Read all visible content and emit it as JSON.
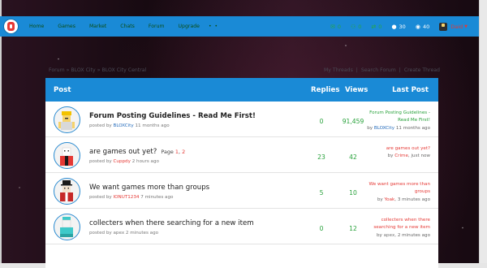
{
  "navbar": {
    "links": [
      "Home",
      "Games",
      "Market",
      "Chats",
      "Forum",
      "Upgrade"
    ],
    "more_label": "• •",
    "stats": {
      "messages": "0",
      "friend_requests": "0",
      "trades": "0",
      "currency_1": "30",
      "currency_2": "40"
    },
    "username": "Daid",
    "colors": {
      "bar": "#1a8ad6",
      "link": "#0c4e13",
      "stat_green": "#26a546",
      "user": "#e53935"
    }
  },
  "breadcrumb": [
    "Forum",
    "BLOX City",
    "BLOX City Central"
  ],
  "breadcrumb_separator": "»",
  "actions": [
    "My Threads",
    "Search Forum",
    "Create Thread"
  ],
  "table": {
    "headers": {
      "post": "Post",
      "replies": "Replies",
      "views": "Views",
      "last_post": "Last Post"
    },
    "rows": [
      {
        "title": "Forum Posting Guidelines - Read Me First!",
        "pages_label": "",
        "pages": [],
        "posted_by_prefix": "posted by",
        "author": "BLOXCity",
        "age": "11 months ago",
        "replies": "0",
        "views": "91,459",
        "last_title": "Forum Posting Guidelines - Read Me First!",
        "last_by_prefix": "by",
        "last_author": "BLOXCity",
        "last_age": "11 months ago"
      },
      {
        "title": "are games out yet?",
        "pages_label": "Page",
        "pages": [
          "1",
          "2"
        ],
        "posted_by_prefix": "posted by",
        "author": "Cuppdy",
        "age": "2 hours ago",
        "replies": "23",
        "views": "42",
        "last_title": "are games out yet?",
        "last_by_prefix": "by",
        "last_author": "Crime",
        "last_age": "just now"
      },
      {
        "title": "We want games more than groups",
        "pages_label": "",
        "pages": [],
        "posted_by_prefix": "posted by",
        "author": "IONUT1234",
        "age": "7 minutes ago",
        "replies": "5",
        "views": "10",
        "last_title": "We want games more than groups",
        "last_by_prefix": "by",
        "last_author": "Yoak",
        "last_age": "3 minutes ago"
      },
      {
        "title": "collecters when there searching for a new item",
        "pages_label": "",
        "pages": [],
        "posted_by_prefix": "posted by",
        "author": "apex",
        "age": "2 minutes ago",
        "replies": "0",
        "views": "12",
        "last_title": "collecters when there searching for a new item",
        "last_by_prefix": "by",
        "last_author": "apex",
        "last_age": "2 minutes ago"
      }
    ]
  },
  "icons": {
    "messages": "envelope-icon",
    "friend_requests": "friends-icon",
    "trades": "trade-icon",
    "currency_1": "coin-icon",
    "currency_2": "cash-icon"
  }
}
